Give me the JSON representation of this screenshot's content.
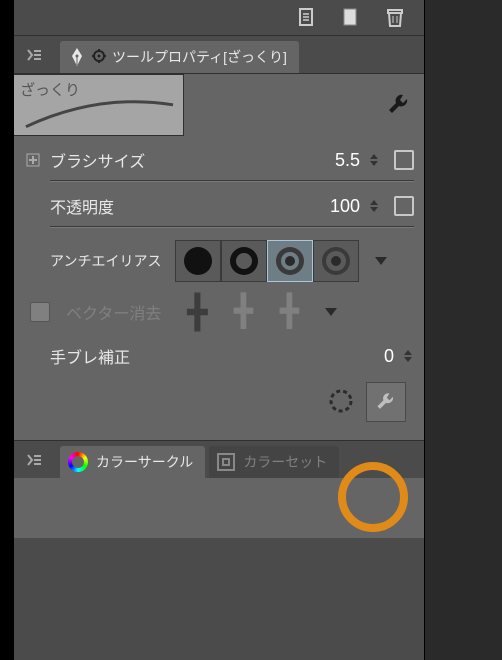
{
  "header": {
    "tab_title": "ツールプロパティ[ざっくり]"
  },
  "preview": {
    "name": "ざっくり"
  },
  "props": {
    "brush_size": {
      "label": "ブラシサイズ",
      "value": "5.5"
    },
    "opacity": {
      "label": "不透明度",
      "value": "100"
    },
    "antialias": {
      "label": "アンチエイリアス"
    },
    "vector_erase": {
      "label": "ベクター消去"
    },
    "stabilize": {
      "label": "手ブレ補正",
      "value": "0"
    }
  },
  "color_panel": {
    "active_tab": "カラーサークル",
    "inactive_tab": "カラーセット"
  }
}
